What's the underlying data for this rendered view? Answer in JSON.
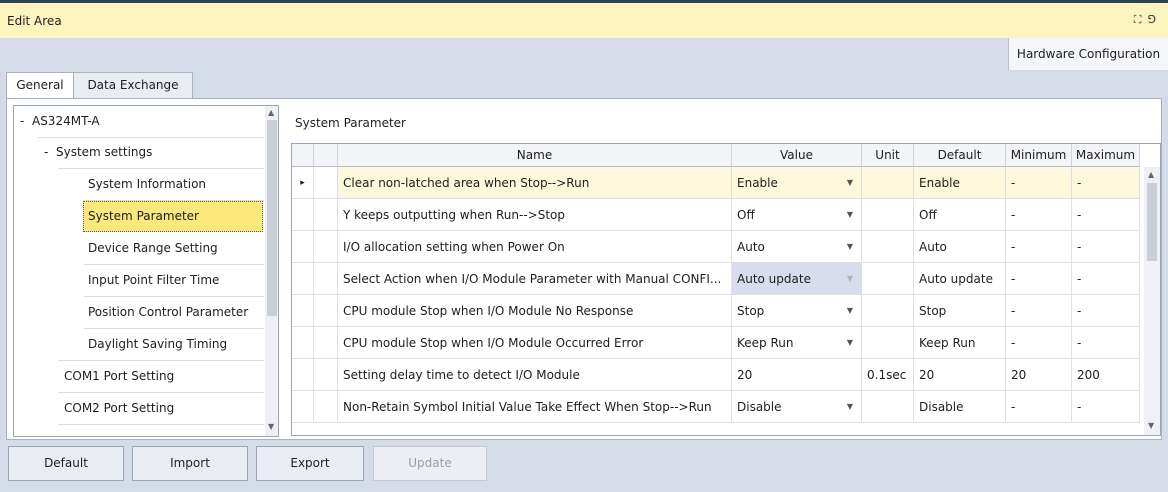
{
  "window": {
    "title": "Edit Area",
    "icons": [
      "maximize-icon",
      "pin-icon"
    ]
  },
  "hw_tab": "Hardware Configuration",
  "tabs": [
    "General",
    "Data Exchange"
  ],
  "tree": {
    "root": {
      "label": "AS324MT-A",
      "expander": "-"
    },
    "group": {
      "label": "System settings",
      "expander": "-"
    },
    "children": [
      "System Information",
      "System Parameter",
      "Device Range Setting",
      "Input Point Filter Time",
      "Position Control Parameter",
      "Daylight Saving Timing"
    ],
    "selected": "System Parameter",
    "siblings": [
      "COM1 Port Setting",
      "COM2 Port Setting"
    ]
  },
  "section_title": "System Parameter",
  "grid": {
    "columns": [
      "Name",
      "Value",
      "Unit",
      "Default",
      "Minimum",
      "Maximum"
    ],
    "rows": [
      {
        "name": "Clear non-latched area when Stop-->Run",
        "value": "Enable",
        "unit": "",
        "default": "Enable",
        "min": "-",
        "max": "-",
        "dropdown": true
      },
      {
        "name": "Y keeps outputting when Run-->Stop",
        "value": "Off",
        "unit": "",
        "default": "Off",
        "min": "-",
        "max": "-",
        "dropdown": true
      },
      {
        "name": "I/O allocation setting when Power On",
        "value": "Auto",
        "unit": "",
        "default": "Auto",
        "min": "-",
        "max": "-",
        "dropdown": true
      },
      {
        "name": "Select Action when I/O Module Parameter with Manual CONFI...",
        "value": "Auto update",
        "unit": "",
        "default": "Auto update",
        "min": "-",
        "max": "-",
        "dropdown": true
      },
      {
        "name": "CPU module Stop when I/O Module No Response",
        "value": "Stop",
        "unit": "",
        "default": "Stop",
        "min": "-",
        "max": "-",
        "dropdown": true
      },
      {
        "name": "CPU module Stop when I/O Module Occurred Error",
        "value": "Keep Run",
        "unit": "",
        "default": "Keep Run",
        "min": "-",
        "max": "-",
        "dropdown": true
      },
      {
        "name": "Setting delay time to detect I/O Module",
        "value": "20",
        "unit": "0.1sec",
        "default": "20",
        "min": "20",
        "max": "200",
        "dropdown": false
      },
      {
        "name": "Non-Retain Symbol Initial Value Take Effect When Stop-->Run",
        "value": "Disable",
        "unit": "",
        "default": "Disable",
        "min": "-",
        "max": "-",
        "dropdown": true
      }
    ],
    "current_row_marker": "▸"
  },
  "buttons": {
    "default": "Default",
    "import": "Import",
    "export": "Export",
    "update": "Update"
  },
  "colors": {
    "selection": "#fbe97c",
    "title_bg": "#fdf4bf",
    "highlight_row": "#fdf8dc",
    "disabled_value": "#d9dcec"
  }
}
